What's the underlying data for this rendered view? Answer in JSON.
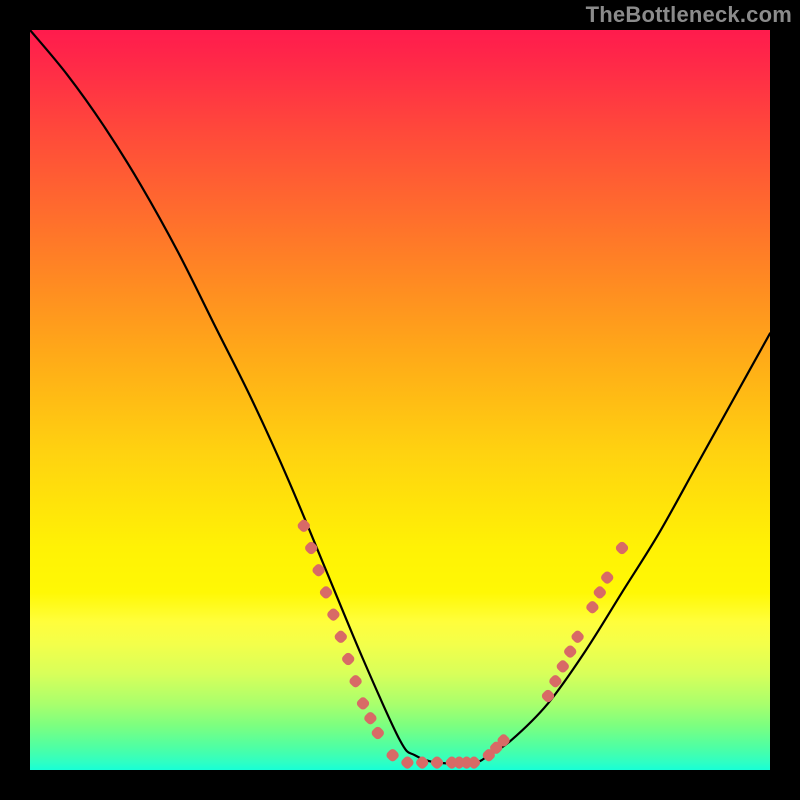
{
  "watermark": {
    "text": "TheBottleneck.com"
  },
  "chart_data": {
    "type": "line",
    "title": "",
    "xlabel": "",
    "ylabel": "",
    "xlim": [
      0,
      100
    ],
    "ylim": [
      0,
      100
    ],
    "grid": false,
    "legend": false,
    "background": {
      "type": "vertical-gradient",
      "stops": [
        {
          "pos": 0.0,
          "color": "#ff1b4d"
        },
        {
          "pos": 0.24,
          "color": "#ff6a2e"
        },
        {
          "pos": 0.5,
          "color": "#ffc012"
        },
        {
          "pos": 0.72,
          "color": "#fff805"
        },
        {
          "pos": 0.88,
          "color": "#c8ff5a"
        },
        {
          "pos": 1.0,
          "color": "#17ffd6"
        }
      ]
    },
    "series": [
      {
        "name": "bottleneck-curve",
        "color": "#000000",
        "x": [
          0,
          5,
          10,
          15,
          20,
          25,
          30,
          35,
          40,
          45,
          50,
          52,
          55,
          60,
          62,
          65,
          70,
          75,
          80,
          85,
          90,
          95,
          100
        ],
        "y": [
          100,
          94,
          87,
          79,
          70,
          60,
          50,
          39,
          27,
          15,
          4,
          2,
          1,
          1,
          2,
          4,
          9,
          16,
          24,
          32,
          41,
          50,
          59
        ]
      }
    ],
    "markers": [
      {
        "name": "left-cluster",
        "shape": "lozenge",
        "color": "#d86a66",
        "points": [
          {
            "x": 37,
            "y": 33
          },
          {
            "x": 38,
            "y": 30
          },
          {
            "x": 39,
            "y": 27
          },
          {
            "x": 40,
            "y": 24
          },
          {
            "x": 41,
            "y": 21
          },
          {
            "x": 42,
            "y": 18
          },
          {
            "x": 43,
            "y": 15
          },
          {
            "x": 44,
            "y": 12
          },
          {
            "x": 45,
            "y": 9
          },
          {
            "x": 46,
            "y": 7
          },
          {
            "x": 47,
            "y": 5
          }
        ]
      },
      {
        "name": "valley-cluster",
        "shape": "lozenge",
        "color": "#d86a66",
        "points": [
          {
            "x": 49,
            "y": 2
          },
          {
            "x": 51,
            "y": 1
          },
          {
            "x": 53,
            "y": 1
          },
          {
            "x": 55,
            "y": 1
          },
          {
            "x": 57,
            "y": 1
          },
          {
            "x": 58,
            "y": 1
          },
          {
            "x": 59,
            "y": 1
          },
          {
            "x": 60,
            "y": 1
          },
          {
            "x": 62,
            "y": 2
          },
          {
            "x": 63,
            "y": 3
          },
          {
            "x": 64,
            "y": 4
          }
        ]
      },
      {
        "name": "right-cluster",
        "shape": "lozenge",
        "color": "#d86a66",
        "points": [
          {
            "x": 70,
            "y": 10
          },
          {
            "x": 71,
            "y": 12
          },
          {
            "x": 72,
            "y": 14
          },
          {
            "x": 73,
            "y": 16
          },
          {
            "x": 74,
            "y": 18
          },
          {
            "x": 76,
            "y": 22
          },
          {
            "x": 77,
            "y": 24
          },
          {
            "x": 78,
            "y": 26
          },
          {
            "x": 80,
            "y": 30
          }
        ]
      }
    ]
  }
}
